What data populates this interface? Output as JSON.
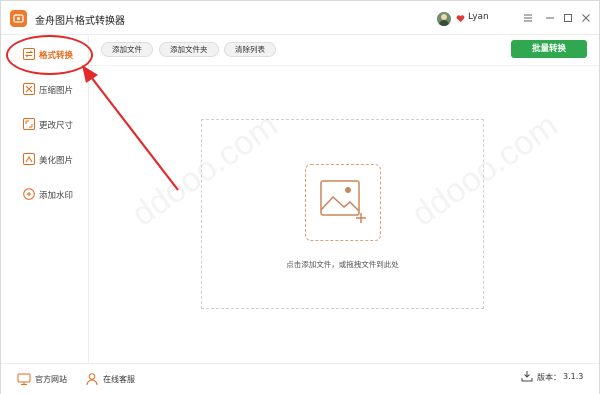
{
  "app": {
    "title": "金舟图片格式转换器",
    "accent": "#f07a2b"
  },
  "user": {
    "name": "Lyan",
    "vip_color": "#e03b3b"
  },
  "window_controls": [
    "menu-icon",
    "minimize-icon",
    "maximize-icon",
    "close-icon"
  ],
  "sidebar": {
    "items": [
      {
        "label": "格式转换",
        "icon": "format-convert-icon",
        "active": true
      },
      {
        "label": "压缩图片",
        "icon": "compress-icon",
        "active": false
      },
      {
        "label": "更改尺寸",
        "icon": "resize-icon",
        "active": false
      },
      {
        "label": "美化图片",
        "icon": "beautify-icon",
        "active": false
      },
      {
        "label": "添加水印",
        "icon": "watermark-icon",
        "active": false
      }
    ]
  },
  "toolbar": {
    "add_file": "添加文件",
    "add_folder": "添加文件夹",
    "clear_list": "清除列表",
    "batch_convert": "批量转换",
    "batch_color": "#2fa84f"
  },
  "dropzone": {
    "hint": "点击添加文件，或拖拽文件到此处",
    "icon": "add-image-icon"
  },
  "footer": {
    "website": "官方网站",
    "support": "在线客服",
    "version_label": "版本：",
    "version_value": "3.1.3"
  },
  "annotation": {
    "highlight_color": "#e22a2a"
  }
}
